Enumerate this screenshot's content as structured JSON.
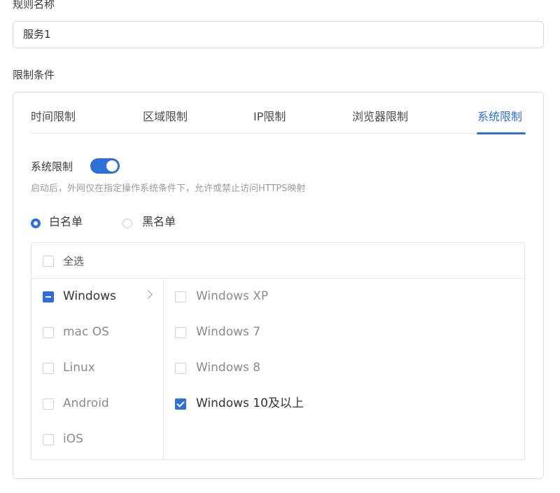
{
  "form": {
    "rule_name_label": "规则名称",
    "rule_name_value": "服务1",
    "limit_label": "限制条件"
  },
  "tabs": [
    {
      "label": "时间限制",
      "active": false
    },
    {
      "label": "区域限制",
      "active": false
    },
    {
      "label": "IP限制",
      "active": false
    },
    {
      "label": "浏览器限制",
      "active": false
    },
    {
      "label": "系统限制",
      "active": true
    }
  ],
  "system_limit": {
    "switch_label": "系统限制",
    "enabled": true,
    "hint": "启动后，外网仅在指定操作系统条件下，允许或禁止访问HTTPS映射"
  },
  "list_mode": {
    "options": [
      {
        "label": "白名单",
        "checked": true
      },
      {
        "label": "黑名单",
        "checked": false
      }
    ]
  },
  "os_selector": {
    "select_all_label": "全选",
    "select_all_checked": false,
    "families": [
      {
        "label": "Windows",
        "state": "indeterminate",
        "expanded": true
      },
      {
        "label": "mac OS",
        "state": "unchecked"
      },
      {
        "label": "Linux",
        "state": "unchecked"
      },
      {
        "label": "Android",
        "state": "unchecked"
      },
      {
        "label": "iOS",
        "state": "unchecked"
      }
    ],
    "windows_versions": [
      {
        "label": "Windows XP",
        "checked": false
      },
      {
        "label": "Windows 7",
        "checked": false
      },
      {
        "label": "Windows 8",
        "checked": false
      },
      {
        "label": "Windows 10及以上",
        "checked": true
      }
    ]
  },
  "colors": {
    "accent": "#2f6fd6",
    "border": "#dcdfe3",
    "muted_text": "#9b9b9b"
  }
}
